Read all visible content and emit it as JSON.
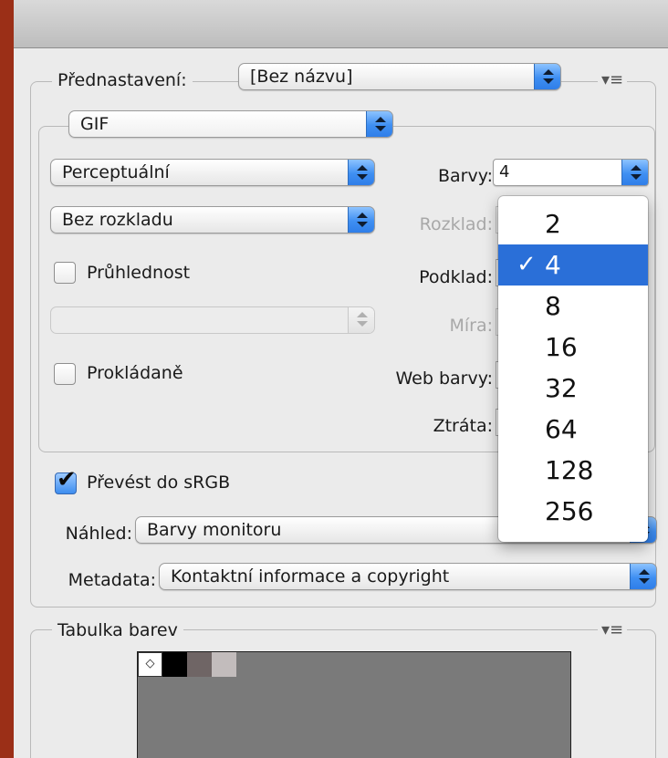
{
  "preset": {
    "label": "Přednastavení:",
    "value": "[Bez názvu]",
    "menu_icon": "options-menu-icon"
  },
  "format": {
    "value": "GIF"
  },
  "reduction": {
    "value": "Perceptuální"
  },
  "dither_algo": {
    "value": "Bez rozkladu"
  },
  "colors": {
    "label": "Barvy:",
    "value": "4"
  },
  "dither": {
    "label": "Rozklad:"
  },
  "transparency": {
    "label": "Průhlednost",
    "checked": false
  },
  "matte": {
    "label": "Podklad:"
  },
  "amount": {
    "label": "Míra:"
  },
  "interlaced": {
    "label": "Prokládaně",
    "checked": false
  },
  "web_snap": {
    "label": "Web barvy:"
  },
  "lossy": {
    "label": "Ztráta:"
  },
  "convert_srgb": {
    "label": "Převést do sRGB",
    "checked": true
  },
  "preview": {
    "label": "Náhled:",
    "value": "Barvy monitoru"
  },
  "metadata": {
    "label": "Metadata:",
    "value": "Kontaktní informace a copyright"
  },
  "color_table": {
    "label": "Tabulka barev",
    "menu_icon": "options-menu-icon"
  },
  "colors_dropdown": {
    "options": [
      "2",
      "4",
      "8",
      "16",
      "32",
      "64",
      "128",
      "256"
    ],
    "selected": "4"
  },
  "swatches": [
    "#ffffff",
    "#000000",
    "#6f6565",
    "#c2bcbc"
  ],
  "accent": "#2a6fd8"
}
